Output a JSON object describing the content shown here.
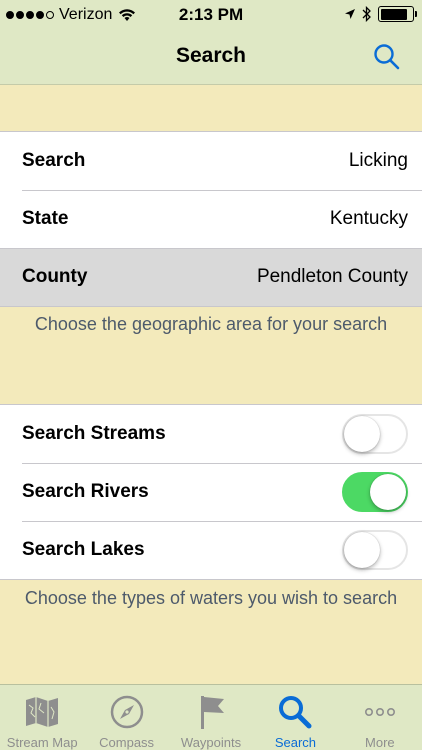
{
  "status": {
    "carrier": "Verizon",
    "time": "2:13 PM",
    "battery_level": 0.85
  },
  "nav": {
    "title": "Search"
  },
  "location": {
    "rows": [
      {
        "label": "Search",
        "value": "Licking"
      },
      {
        "label": "State",
        "value": "Kentucky"
      },
      {
        "label": "County",
        "value": "Pendleton County"
      }
    ],
    "footer": "Choose the geographic area for your search"
  },
  "waters": {
    "rows": [
      {
        "label": "Search Streams",
        "on": false
      },
      {
        "label": "Search Rivers",
        "on": true
      },
      {
        "label": "Search Lakes",
        "on": false
      }
    ],
    "footer": "Choose the types of waters you wish to search"
  },
  "tabs": [
    {
      "label": "Stream Map",
      "icon": "map-icon"
    },
    {
      "label": "Compass",
      "icon": "compass-icon"
    },
    {
      "label": "Waypoints",
      "icon": "flag-icon"
    },
    {
      "label": "Search",
      "icon": "search-icon",
      "active": true
    },
    {
      "label": "More",
      "icon": "more-icon"
    }
  ],
  "colors": {
    "background": "#f3eabb",
    "bars": "#dfe8c5",
    "accent": "#0a6cd6",
    "toggle_on": "#4cd964"
  }
}
